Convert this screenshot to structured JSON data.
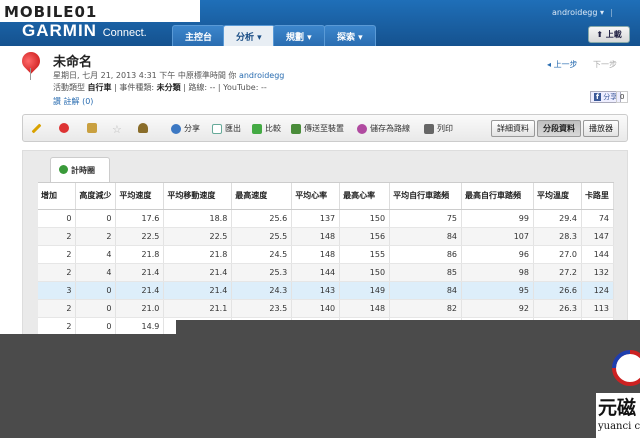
{
  "brand": {
    "mobile01": "MOBILE01",
    "garmin": "GARMIN",
    "connect": "Connect."
  },
  "header": {
    "user": "androidegg",
    "nav": [
      {
        "label": "主控台"
      },
      {
        "label": "分析 ▾"
      },
      {
        "label": "規劃 ▾"
      },
      {
        "label": "探索 ▾"
      }
    ],
    "upload_label": "上載"
  },
  "activity": {
    "title": "未命名",
    "date_text": "星期日, 七月 21, 2013 4:31 下午 中原標準時間 你",
    "owner": "androidegg",
    "type_label": "活動類型",
    "type_value": "自行車",
    "event_label": "事件種類:",
    "event_value": "未分類",
    "route_label": "路線:",
    "route_value": "--",
    "youtube": "YouTube: --",
    "like": "讚",
    "comments": "註解 (0)",
    "prev": "上一步",
    "next": "下一步",
    "fb_share": "分享",
    "fb_count": "0"
  },
  "toolbar": {
    "share": "分享",
    "export": "匯出",
    "compare": "比較",
    "send": "傳送至裝置",
    "save_route": "儲存為路線",
    "print": "列印",
    "view_detail": "詳細資料",
    "view_split": "分段資料",
    "view_player": "播放器"
  },
  "laps": {
    "tab_label": "計時圈",
    "columns": [
      "增加",
      "高度減少",
      "平均速度",
      "平均移動速度",
      "最高速度",
      "平均心率",
      "最高心率",
      "平均自行車踏頻",
      "最高自行車踏頻",
      "平均溫度",
      "卡路里"
    ],
    "rows": [
      [
        "0",
        "0",
        "17.6",
        "18.8",
        "25.6",
        "137",
        "150",
        "75",
        "99",
        "29.4",
        "74"
      ],
      [
        "2",
        "2",
        "22.5",
        "22.5",
        "25.5",
        "148",
        "156",
        "84",
        "107",
        "28.3",
        "147"
      ],
      [
        "2",
        "4",
        "21.8",
        "21.8",
        "24.5",
        "148",
        "155",
        "86",
        "96",
        "27.0",
        "144"
      ],
      [
        "2",
        "4",
        "21.4",
        "21.4",
        "25.3",
        "144",
        "150",
        "85",
        "98",
        "27.2",
        "132"
      ],
      [
        "3",
        "0",
        "21.4",
        "21.4",
        "24.3",
        "143",
        "149",
        "84",
        "95",
        "26.6",
        "124"
      ],
      [
        "2",
        "0",
        "21.0",
        "21.1",
        "23.5",
        "140",
        "148",
        "82",
        "92",
        "26.3",
        "113"
      ],
      [
        "2",
        "0",
        "14.9",
        "",
        "",
        "",
        "",
        "",
        "",
        "",
        ""
      ]
    ],
    "selected_row": 4
  },
  "watermark": {
    "zh": "元磁",
    "en": "yuanci c"
  }
}
